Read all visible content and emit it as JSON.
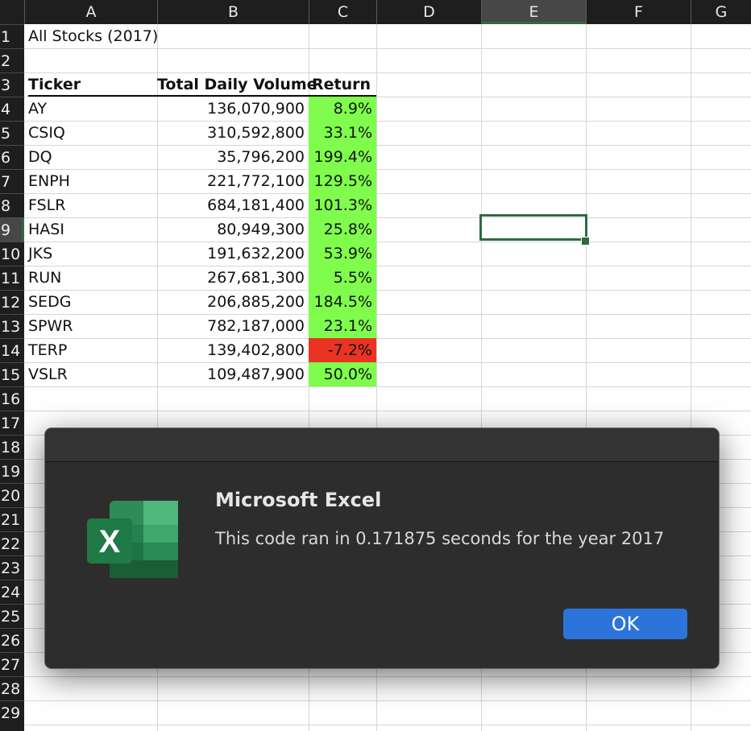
{
  "columns": [
    "A",
    "B",
    "C",
    "D",
    "E",
    "F",
    "G"
  ],
  "selected_column": "E",
  "rows": [
    "1",
    "2",
    "3",
    "4",
    "5",
    "6",
    "7",
    "8",
    "9",
    "10",
    "11",
    "12",
    "13",
    "14",
    "15",
    "16",
    "17",
    "18",
    "19",
    "20",
    "21",
    "22",
    "23",
    "24",
    "25",
    "26",
    "27",
    "28",
    "29"
  ],
  "selected_row": "9",
  "sheet": {
    "title": "All Stocks (2017)",
    "headers": {
      "ticker": "Ticker",
      "volume": "Total Daily Volume",
      "return": "Return"
    },
    "data": [
      {
        "ticker": "AY",
        "volume": "136,070,900",
        "return": "8.9%",
        "status": "positive"
      },
      {
        "ticker": "CSIQ",
        "volume": "310,592,800",
        "return": "33.1%",
        "status": "positive"
      },
      {
        "ticker": "DQ",
        "volume": "35,796,200",
        "return": "199.4%",
        "status": "positive"
      },
      {
        "ticker": "ENPH",
        "volume": "221,772,100",
        "return": "129.5%",
        "status": "positive"
      },
      {
        "ticker": "FSLR",
        "volume": "684,181,400",
        "return": "101.3%",
        "status": "positive"
      },
      {
        "ticker": "HASI",
        "volume": "80,949,300",
        "return": "25.8%",
        "status": "positive"
      },
      {
        "ticker": "JKS",
        "volume": "191,632,200",
        "return": "53.9%",
        "status": "positive"
      },
      {
        "ticker": "RUN",
        "volume": "267,681,300",
        "return": "5.5%",
        "status": "positive"
      },
      {
        "ticker": "SEDG",
        "volume": "206,885,200",
        "return": "184.5%",
        "status": "positive"
      },
      {
        "ticker": "SPWR",
        "volume": "782,187,000",
        "return": "23.1%",
        "status": "positive"
      },
      {
        "ticker": "TERP",
        "volume": "139,402,800",
        "return": "-7.2%",
        "status": "negative"
      },
      {
        "ticker": "VSLR",
        "volume": "109,487,900",
        "return": "50.0%",
        "status": "positive"
      }
    ]
  },
  "colors": {
    "positive": "#7ffc4c",
    "negative": "#ea3323",
    "selection": "#2e6b3e",
    "ok_button": "#2c74d9"
  },
  "dialog": {
    "title": "Microsoft Excel",
    "message": "This code ran in 0.171875 seconds for the year 2017",
    "ok_label": "OK",
    "icon": "excel-icon",
    "icon_letter": "X"
  }
}
